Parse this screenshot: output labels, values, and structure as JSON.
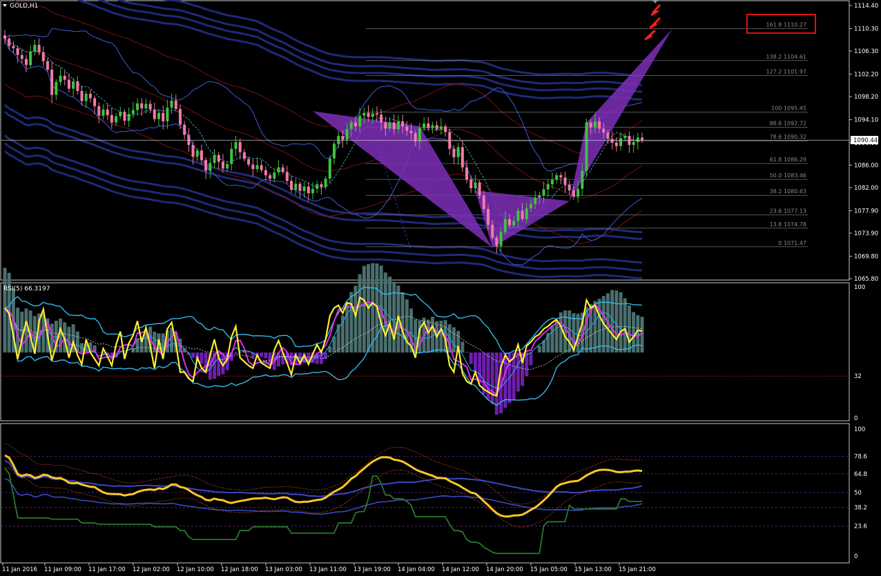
{
  "chart_title": "GOLD,H1",
  "rsi_label": "RSI(5) 66.3197",
  "price_label": "1090.44",
  "colors": {
    "bull": "#3cc43c",
    "bear": "#f27aa6",
    "pattern": "#7e2fb8",
    "fib": "#8a8a8a",
    "frame": "#c9c9c9",
    "highlight_box": "#e01010",
    "rsi_yellow": "#ffee33",
    "rsi_cyan": "#36b8e8",
    "rsi_magenta": "#e22de6",
    "hist_purple": "#6c1fb0",
    "hist_gray": "#4a6e6e",
    "p3_yellow": "#ffc726",
    "p3_green": "#287a28",
    "p3_blue": "#3a48c8"
  },
  "chart_data": [
    {
      "type": "candlestick",
      "title": "GOLD,H1",
      "ylim": [
        1065.8,
        1114.4
      ],
      "y_ticks": [
        {
          "value": 1114.4,
          "label": "1114.40"
        },
        {
          "value": 1110.3,
          "label": "1110.30"
        },
        {
          "value": 1106.3,
          "label": "1106.30"
        },
        {
          "value": 1102.2,
          "label": "1102.20"
        },
        {
          "value": 1098.2,
          "label": "1098.20"
        },
        {
          "value": 1094.1,
          "label": "1094.10"
        },
        {
          "value": 1090.0,
          "label": "1090.00"
        },
        {
          "value": 1086.0,
          "label": "1086.00"
        },
        {
          "value": 1082.0,
          "label": "1082.00"
        },
        {
          "value": 1077.9,
          "label": "1077.90"
        },
        {
          "value": 1073.9,
          "label": "1073.90"
        },
        {
          "value": 1069.8,
          "label": "1069.80"
        },
        {
          "value": 1065.8,
          "label": "1065.80"
        }
      ],
      "x_tick_labels": [
        "11 Jan 2016",
        "11 Jan 09:00",
        "11 Jan 17:00",
        "12 Jan 02:00",
        "12 Jan 10:00",
        "12 Jan 18:00",
        "13 Jan 03:00",
        "13 Jan 11:00",
        "13 Jan 19:00",
        "14 Jan 04:00",
        "14 Jan 12:00",
        "14 Jan 20:00",
        "15 Jan 05:00",
        "15 Jan 13:00",
        "15 Jan 21:00"
      ],
      "current_price": 1090.44,
      "fib_levels": [
        {
          "label": "161.8 1110.27",
          "value": 1110.27,
          "highlight": true
        },
        {
          "label": "138.2 1104.61",
          "value": 1104.61
        },
        {
          "label": "127.2 1101.97",
          "value": 1101.97
        },
        {
          "label": "100 1095.45",
          "value": 1095.45
        },
        {
          "label": "88.6 1092.72",
          "value": 1092.72
        },
        {
          "label": "78.6 1090.32",
          "value": 1090.32
        },
        {
          "label": "61.8 1086.29",
          "value": 1086.29
        },
        {
          "label": "50.0 1083.46",
          "value": 1083.46
        },
        {
          "label": "38.2 1080.63",
          "value": 1080.63
        },
        {
          "label": "23.6 1077.13",
          "value": 1077.13
        },
        {
          "label": "13.8 1074.78",
          "value": 1074.78
        },
        {
          "label": "0 1071.47",
          "value": 1071.47
        }
      ],
      "close": [
        1108.5,
        1107.2,
        1106.8,
        1105.6,
        1104.9,
        1103.8,
        1106.2,
        1107.4,
        1106.1,
        1104.5,
        1103.0,
        1098.5,
        1100.8,
        1101.9,
        1101.2,
        1099.6,
        1100.9,
        1099.2,
        1097.4,
        1098.7,
        1097.9,
        1096.5,
        1094.8,
        1095.9,
        1094.9,
        1093.6,
        1094.7,
        1095.5,
        1093.9,
        1095.1,
        1095.8,
        1097.0,
        1096.1,
        1096.9,
        1095.9,
        1094.2,
        1095.3,
        1093.8,
        1096.2,
        1097.5,
        1096.0,
        1093.2,
        1091.4,
        1089.6,
        1087.5,
        1088.6,
        1086.9,
        1085.0,
        1086.4,
        1087.8,
        1086.6,
        1085.4,
        1086.2,
        1088.9,
        1090.1,
        1088.3,
        1087.1,
        1086.1,
        1085.3,
        1086.0,
        1085.1,
        1084.2,
        1083.6,
        1084.7,
        1085.6,
        1084.8,
        1083.2,
        1081.6,
        1082.7,
        1081.4,
        1082.2,
        1081.0,
        1081.8,
        1082.6,
        1082.1,
        1083.6,
        1087.2,
        1089.8,
        1091.2,
        1090.5,
        1092.4,
        1093.6,
        1092.9,
        1094.8,
        1095.3,
        1094.6,
        1095.2,
        1095.0,
        1093.6,
        1092.5,
        1093.6,
        1092.4,
        1093.8,
        1092.9,
        1092.1,
        1091.7,
        1090.2,
        1092.6,
        1093.4,
        1092.6,
        1093.1,
        1092.4,
        1092.9,
        1091.9,
        1088.9,
        1087.4,
        1089.2,
        1085.6,
        1083.4,
        1081.9,
        1082.9,
        1080.6,
        1078.2,
        1075.4,
        1073.1,
        1071.6,
        1074.1,
        1076.4,
        1075.3,
        1076.1,
        1077.9,
        1076.4,
        1078.3,
        1079.1,
        1080.2,
        1080.6,
        1081.7,
        1082.6,
        1083.4,
        1084.2,
        1083.8,
        1082.5,
        1081.5,
        1080.4,
        1081.8,
        1085.0,
        1093.6,
        1092.7,
        1093.8,
        1092.5,
        1091.8,
        1090.7,
        1090.0,
        1089.4,
        1090.8,
        1091.2,
        1089.6,
        1090.1,
        1090.9,
        1090.44
      ]
    },
    {
      "type": "oscillator",
      "title": "RSI(5) 66.3197",
      "ylim": [
        0,
        100
      ],
      "levels": [
        32
      ],
      "y_tick_labels": [
        "100",
        "32",
        "0"
      ],
      "rsi5": [
        84,
        80,
        63,
        45,
        60,
        74,
        62,
        49,
        74,
        83,
        63,
        44,
        56,
        68,
        60,
        46,
        58,
        48,
        41,
        60,
        50,
        45,
        40,
        53,
        47,
        40,
        56,
        66,
        45,
        57,
        63,
        74,
        58,
        69,
        55,
        38,
        60,
        45,
        68,
        73,
        57,
        35,
        35,
        30,
        28,
        46,
        38,
        35,
        48,
        60,
        46,
        40,
        45,
        62,
        70,
        46,
        43,
        40,
        38,
        48,
        42,
        40,
        38,
        52,
        59,
        50,
        42,
        33,
        48,
        42,
        48,
        41,
        49,
        56,
        50,
        60,
        78,
        84,
        86,
        80,
        88,
        87,
        78,
        92,
        90,
        84,
        88,
        85,
        72,
        63,
        72,
        60,
        78,
        66,
        58,
        55,
        46,
        68,
        73,
        65,
        70,
        62,
        68,
        60,
        40,
        35,
        55,
        34,
        28,
        26,
        35,
        25,
        22,
        20,
        18,
        17,
        39,
        48,
        43,
        46,
        56,
        42,
        55,
        58,
        62,
        64,
        68,
        70,
        73,
        75,
        70,
        62,
        58,
        52,
        62,
        72,
        90,
        84,
        86,
        78,
        72,
        68,
        64,
        60,
        66,
        68,
        58,
        62,
        67,
        66.3
      ]
    },
    {
      "type": "oscillator",
      "title": "",
      "ylim": [
        0,
        100
      ],
      "y_tick_labels": [
        "100",
        "78.6",
        "64.8",
        "50",
        "38.2",
        "23.6",
        "0"
      ]
    }
  ]
}
